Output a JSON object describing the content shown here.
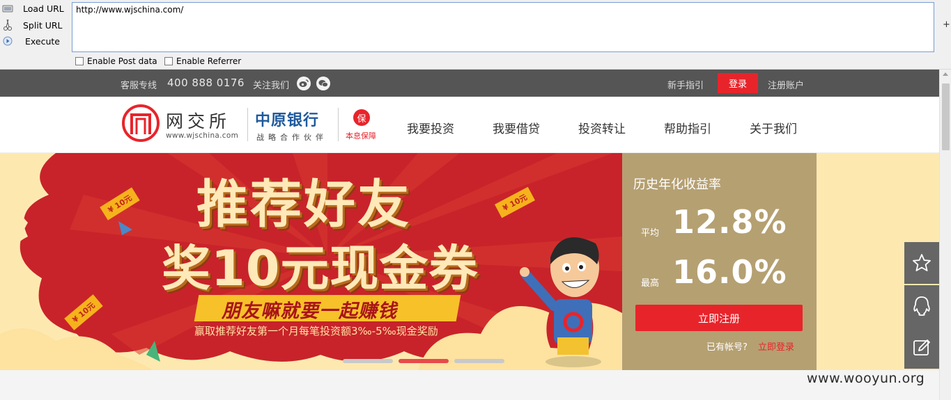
{
  "hackbar": {
    "load_url": "Load URL",
    "split_url": "Split URL",
    "execute": "Execute",
    "url_value": "http://www.wjschina.com/",
    "plus": "+",
    "enable_post": "Enable Post data",
    "enable_referrer": "Enable Referrer"
  },
  "topbar": {
    "service_label": "客服专线",
    "service_phone": "400 888 0176",
    "follow_label": "关注我们",
    "newbie_guide": "新手指引",
    "login": "登录",
    "register": "注册账户"
  },
  "header": {
    "logo_name": "网交所",
    "logo_url": "www.wjschina.com",
    "bank_name": "中原银行",
    "bank_sub": "战略合作伙伴",
    "badge_char": "保",
    "badge_text": "本息保障",
    "nav": [
      "我要投资",
      "我要借贷",
      "投资转让",
      "帮助指引",
      "关于我们"
    ]
  },
  "banner": {
    "headline_1": "推荐好友",
    "headline_2": "奖10元现金券",
    "ribbon": "朋友嘛就要一起赚钱",
    "sub": "赢取推荐好友第一个月每笔投资额3‰-5‰现金奖励",
    "coupon": "¥ 10元",
    "slide_count": 3,
    "active_slide": 2
  },
  "rates": {
    "title": "历史年化收益率",
    "avg_label": "平均",
    "avg_value": "12.8%",
    "max_label": "最高",
    "max_value": "16.0%",
    "register_button": "立即注册",
    "has_account": "已有帐号?",
    "login_now": "立即登录"
  },
  "colors": {
    "accent_red": "#e8242b",
    "topbar_gray": "#555555",
    "panel_gold": "#b5a072",
    "bank_blue": "#1f5a9e"
  },
  "side_tools": [
    "star-icon",
    "qq-icon",
    "edit-icon"
  ],
  "watermark": "www.wooyun.org"
}
